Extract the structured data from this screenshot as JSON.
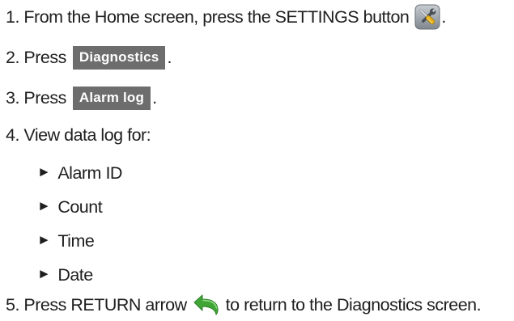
{
  "steps": [
    {
      "number": "1.",
      "before": "From the Home screen, press the SETTINGS button",
      "after": ".",
      "icon": "settings-tools-icon"
    },
    {
      "number": "2.",
      "before": "Press",
      "button": "Diagnostics",
      "after": "."
    },
    {
      "number": "3.",
      "before": "Press",
      "button": "Alarm log",
      "after": "."
    },
    {
      "number": "4.",
      "text": "View data log for:"
    },
    {
      "number": "5.",
      "before": "Press RETURN arrow",
      "after": "to return to the Diagnostics screen.",
      "icon": "return-arrow-icon"
    }
  ],
  "bullet_glyph": "►",
  "log_fields": [
    "Alarm ID",
    "Count",
    "Time",
    "Date"
  ],
  "colors": {
    "button_bg": "#6d6d6d",
    "button_text": "#ffffff",
    "return_arrow": "#3fa535",
    "settings_icon_bg": "#9aa0a6"
  }
}
